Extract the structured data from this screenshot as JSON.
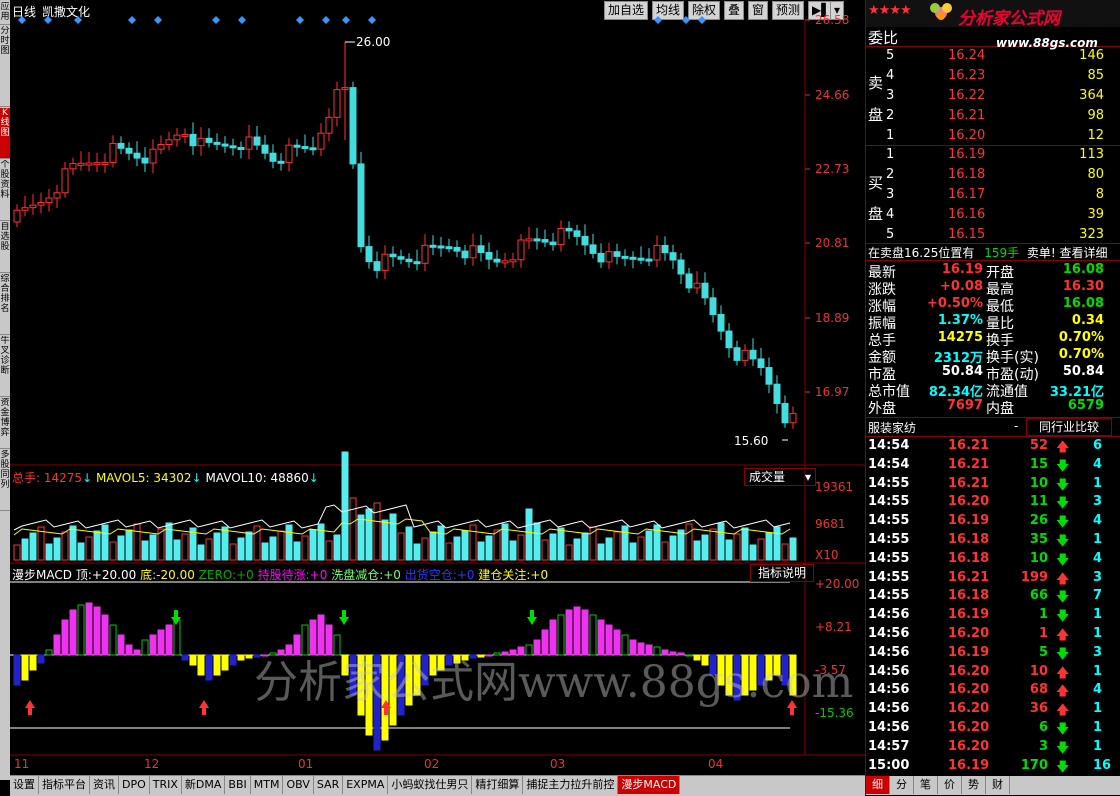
{
  "left_tabs": [
    "应用",
    "分时图",
    "K线图",
    "个股资料",
    "自选股",
    "综合排名",
    "牛叉诊断",
    "资金博弈",
    "多股同列"
  ],
  "header": {
    "period": "日线",
    "stock_name": "凯撒文化"
  },
  "toolbar": [
    "加自选",
    "均线",
    "除权",
    "叠",
    "窗",
    "预测"
  ],
  "price_axis": [
    "26.58",
    "24.66",
    "22.73",
    "20.81",
    "18.89",
    "16.97"
  ],
  "high_annotation": "26.00",
  "low_annotation": "15.60",
  "volume": {
    "title_label": "总手:",
    "total": "14275",
    "mavol5_label": "MAVOL5:",
    "mavol5": "34302",
    "mavol10_label": "MAVOL10:",
    "mavol10": "48860",
    "dropdown": "成交量",
    "axis": [
      "19361",
      "9681",
      "X10"
    ]
  },
  "macd": {
    "title": "漫步MACD",
    "top_label": "顶:",
    "top": "+20.00",
    "bottom_label": "底:",
    "bottom": "-20.00",
    "zero_label": "ZERO:",
    "zero": "+0",
    "hold_label": "持股待涨:",
    "hold": "+0",
    "wash_label": "洗盘减仓:",
    "wash": "+0",
    "exit_label": "出货空仓:",
    "exit": "+0",
    "build_label": "建仓关注:",
    "build": "+0",
    "help_button": "指标说明",
    "axis": [
      "+20.00",
      "+8.21",
      "-3.57",
      "-15.36"
    ]
  },
  "watermark": "分析家公式网www.88gs.com",
  "date_axis": [
    "11",
    "12",
    "01",
    "02",
    "03",
    "04"
  ],
  "bottom_tabs": [
    "设置",
    "指标平台",
    "资讯",
    "DPO",
    "TRIX",
    "新DMA",
    "BBI",
    "MTM",
    "OBV",
    "SAR",
    "EXPMA",
    "小蚂蚁找仕男只",
    "精打细算",
    "捕捉主力拉升前控",
    "漫步MACD"
  ],
  "right": {
    "logo_text": "分析家公式网",
    "logo_url": "www.88gs.com",
    "ratio_label": "委比",
    "sell_label": [
      "卖",
      "盘"
    ],
    "buy_label": [
      "买",
      "盘"
    ],
    "sell": [
      {
        "n": "5",
        "p": "16.24",
        "v": "146"
      },
      {
        "n": "4",
        "p": "16.23",
        "v": "85"
      },
      {
        "n": "3",
        "p": "16.22",
        "v": "364"
      },
      {
        "n": "2",
        "p": "16.21",
        "v": "98"
      },
      {
        "n": "1",
        "p": "16.20",
        "v": "12"
      }
    ],
    "buy": [
      {
        "n": "1",
        "p": "16.19",
        "v": "113"
      },
      {
        "n": "2",
        "p": "16.18",
        "v": "80"
      },
      {
        "n": "3",
        "p": "16.17",
        "v": "8"
      },
      {
        "n": "4",
        "p": "16.16",
        "v": "39"
      },
      {
        "n": "5",
        "p": "16.15",
        "v": "323"
      }
    ],
    "notice_a": "在卖盘16.25位置有",
    "notice_b": "159手",
    "notice_c": "卖单! 查看详细",
    "stats": [
      {
        "l1": "最新",
        "v1": "16.19",
        "c1": "red",
        "l2": "开盘",
        "v2": "16.08",
        "c2": "green"
      },
      {
        "l1": "涨跌",
        "v1": "+0.08",
        "c1": "red",
        "l2": "最高",
        "v2": "16.30",
        "c2": "red"
      },
      {
        "l1": "涨幅",
        "v1": "+0.50%",
        "c1": "red",
        "l2": "最低",
        "v2": "16.08",
        "c2": "green"
      },
      {
        "l1": "振幅",
        "v1": "1.37%",
        "c1": "cyan",
        "l2": "量比",
        "v2": "0.34",
        "c2": "yellow"
      },
      {
        "l1": "总手",
        "v1": "14275",
        "c1": "yellow",
        "l2": "换手",
        "v2": "0.70%",
        "c2": "yellow"
      },
      {
        "l1": "金额",
        "v1": "2312万",
        "c1": "cyan",
        "l2": "换手(实)",
        "v2": "0.70%",
        "c2": "yellow"
      },
      {
        "l1": "市盈",
        "v1": "50.84",
        "c1": "white",
        "l2": "市盈(动)",
        "v2": "50.84",
        "c2": "white"
      },
      {
        "l1": "总市值",
        "v1": "82.34亿",
        "c1": "cyan",
        "l2": "流通值",
        "v2": "33.21亿",
        "c2": "cyan"
      },
      {
        "l1": "外盘",
        "v1": "7697",
        "c1": "red",
        "l2": "内盘",
        "v2": "6579",
        "c2": "green"
      }
    ],
    "industry": "服装家纺",
    "industry_dash": "-",
    "compare_button": "同行业比较",
    "ticks": [
      {
        "t": "14:54",
        "p": "16.21",
        "v": "52",
        "d": "up",
        "e": "6"
      },
      {
        "t": "14:54",
        "p": "16.21",
        "v": "15",
        "d": "down",
        "e": "4"
      },
      {
        "t": "14:55",
        "p": "16.21",
        "v": "10",
        "d": "down",
        "e": "1"
      },
      {
        "t": "14:55",
        "p": "16.20",
        "v": "11",
        "d": "down",
        "e": "3"
      },
      {
        "t": "14:55",
        "p": "16.19",
        "v": "26",
        "d": "down",
        "e": "4"
      },
      {
        "t": "14:55",
        "p": "16.18",
        "v": "35",
        "d": "down",
        "e": "1"
      },
      {
        "t": "14:55",
        "p": "16.18",
        "v": "10",
        "d": "down",
        "e": "4"
      },
      {
        "t": "14:55",
        "p": "16.21",
        "v": "199",
        "d": "up",
        "e": "3"
      },
      {
        "t": "14:55",
        "p": "16.18",
        "v": "66",
        "d": "down",
        "e": "7"
      },
      {
        "t": "14:56",
        "p": "16.19",
        "v": "1",
        "d": "down",
        "e": "1"
      },
      {
        "t": "14:56",
        "p": "16.20",
        "v": "1",
        "d": "up",
        "e": "1"
      },
      {
        "t": "14:56",
        "p": "16.19",
        "v": "5",
        "d": "down",
        "e": "3"
      },
      {
        "t": "14:56",
        "p": "16.20",
        "v": "10",
        "d": "up",
        "e": "1"
      },
      {
        "t": "14:56",
        "p": "16.20",
        "v": "68",
        "d": "up",
        "e": "4"
      },
      {
        "t": "14:56",
        "p": "16.20",
        "v": "36",
        "d": "up",
        "e": "1"
      },
      {
        "t": "14:56",
        "p": "16.20",
        "v": "6",
        "d": "down",
        "e": "1"
      },
      {
        "t": "14:57",
        "p": "16.20",
        "v": "3",
        "d": "down",
        "e": "1"
      },
      {
        "t": "15:00",
        "p": "16.19",
        "v": "170",
        "d": "down",
        "e": "16"
      }
    ],
    "bottom_tabs": [
      "细",
      "分",
      "笔",
      "价",
      "势",
      "财"
    ]
  }
}
